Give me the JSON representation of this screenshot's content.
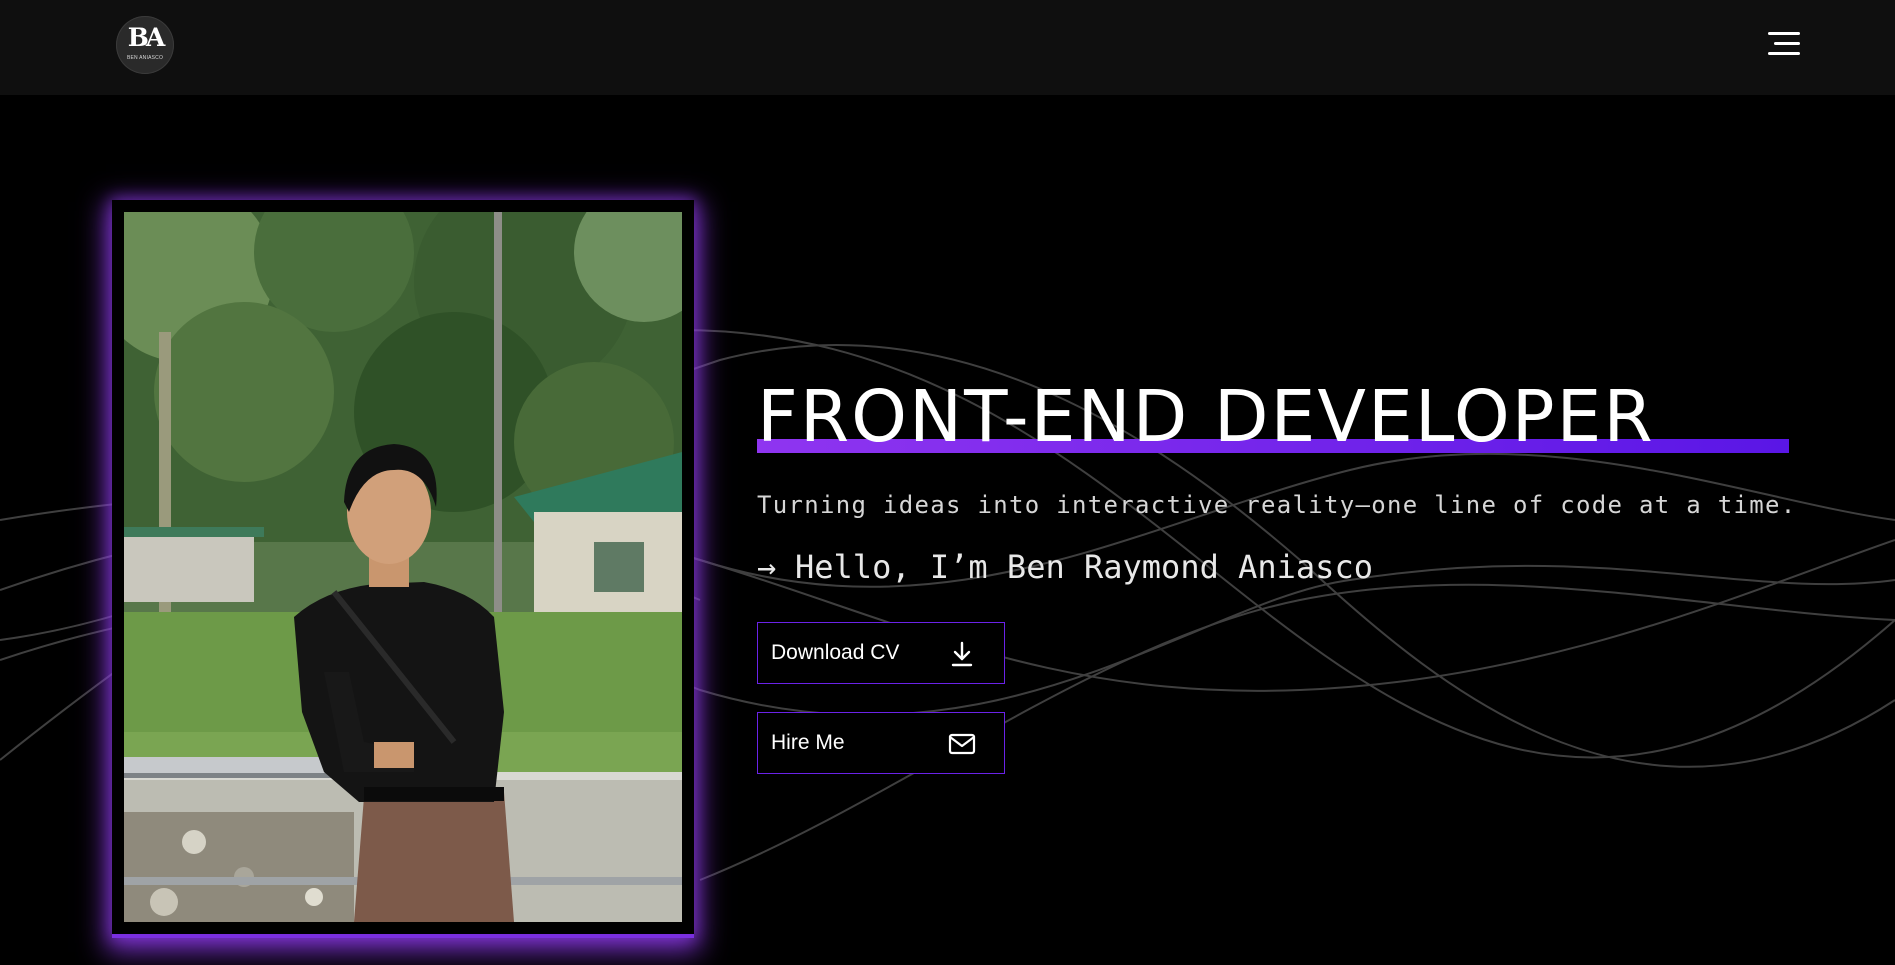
{
  "header": {
    "logo": {
      "mark": "BA",
      "subtitle": "BEN ANIASCO",
      "icon": "logo-monogram"
    },
    "menu_icon": "hamburger-menu-icon"
  },
  "hero": {
    "title": "FRONT-END DEVELOPER",
    "tagline": "Turning ideas into interactive reality—one line of code at a time.",
    "greeting_arrow": "→",
    "greeting_prefix": "Hello, I’m ",
    "name": "Ben Raymond Aniasco",
    "buttons": [
      {
        "label": "Download CV",
        "icon": "download-icon"
      },
      {
        "label": "Hire Me",
        "icon": "mail-icon"
      }
    ]
  },
  "colors": {
    "accent": "#6a22e8",
    "accent_light": "#8f35f0",
    "background": "#000000",
    "header_bg": "#0f0f0f",
    "text": "#ffffff"
  }
}
